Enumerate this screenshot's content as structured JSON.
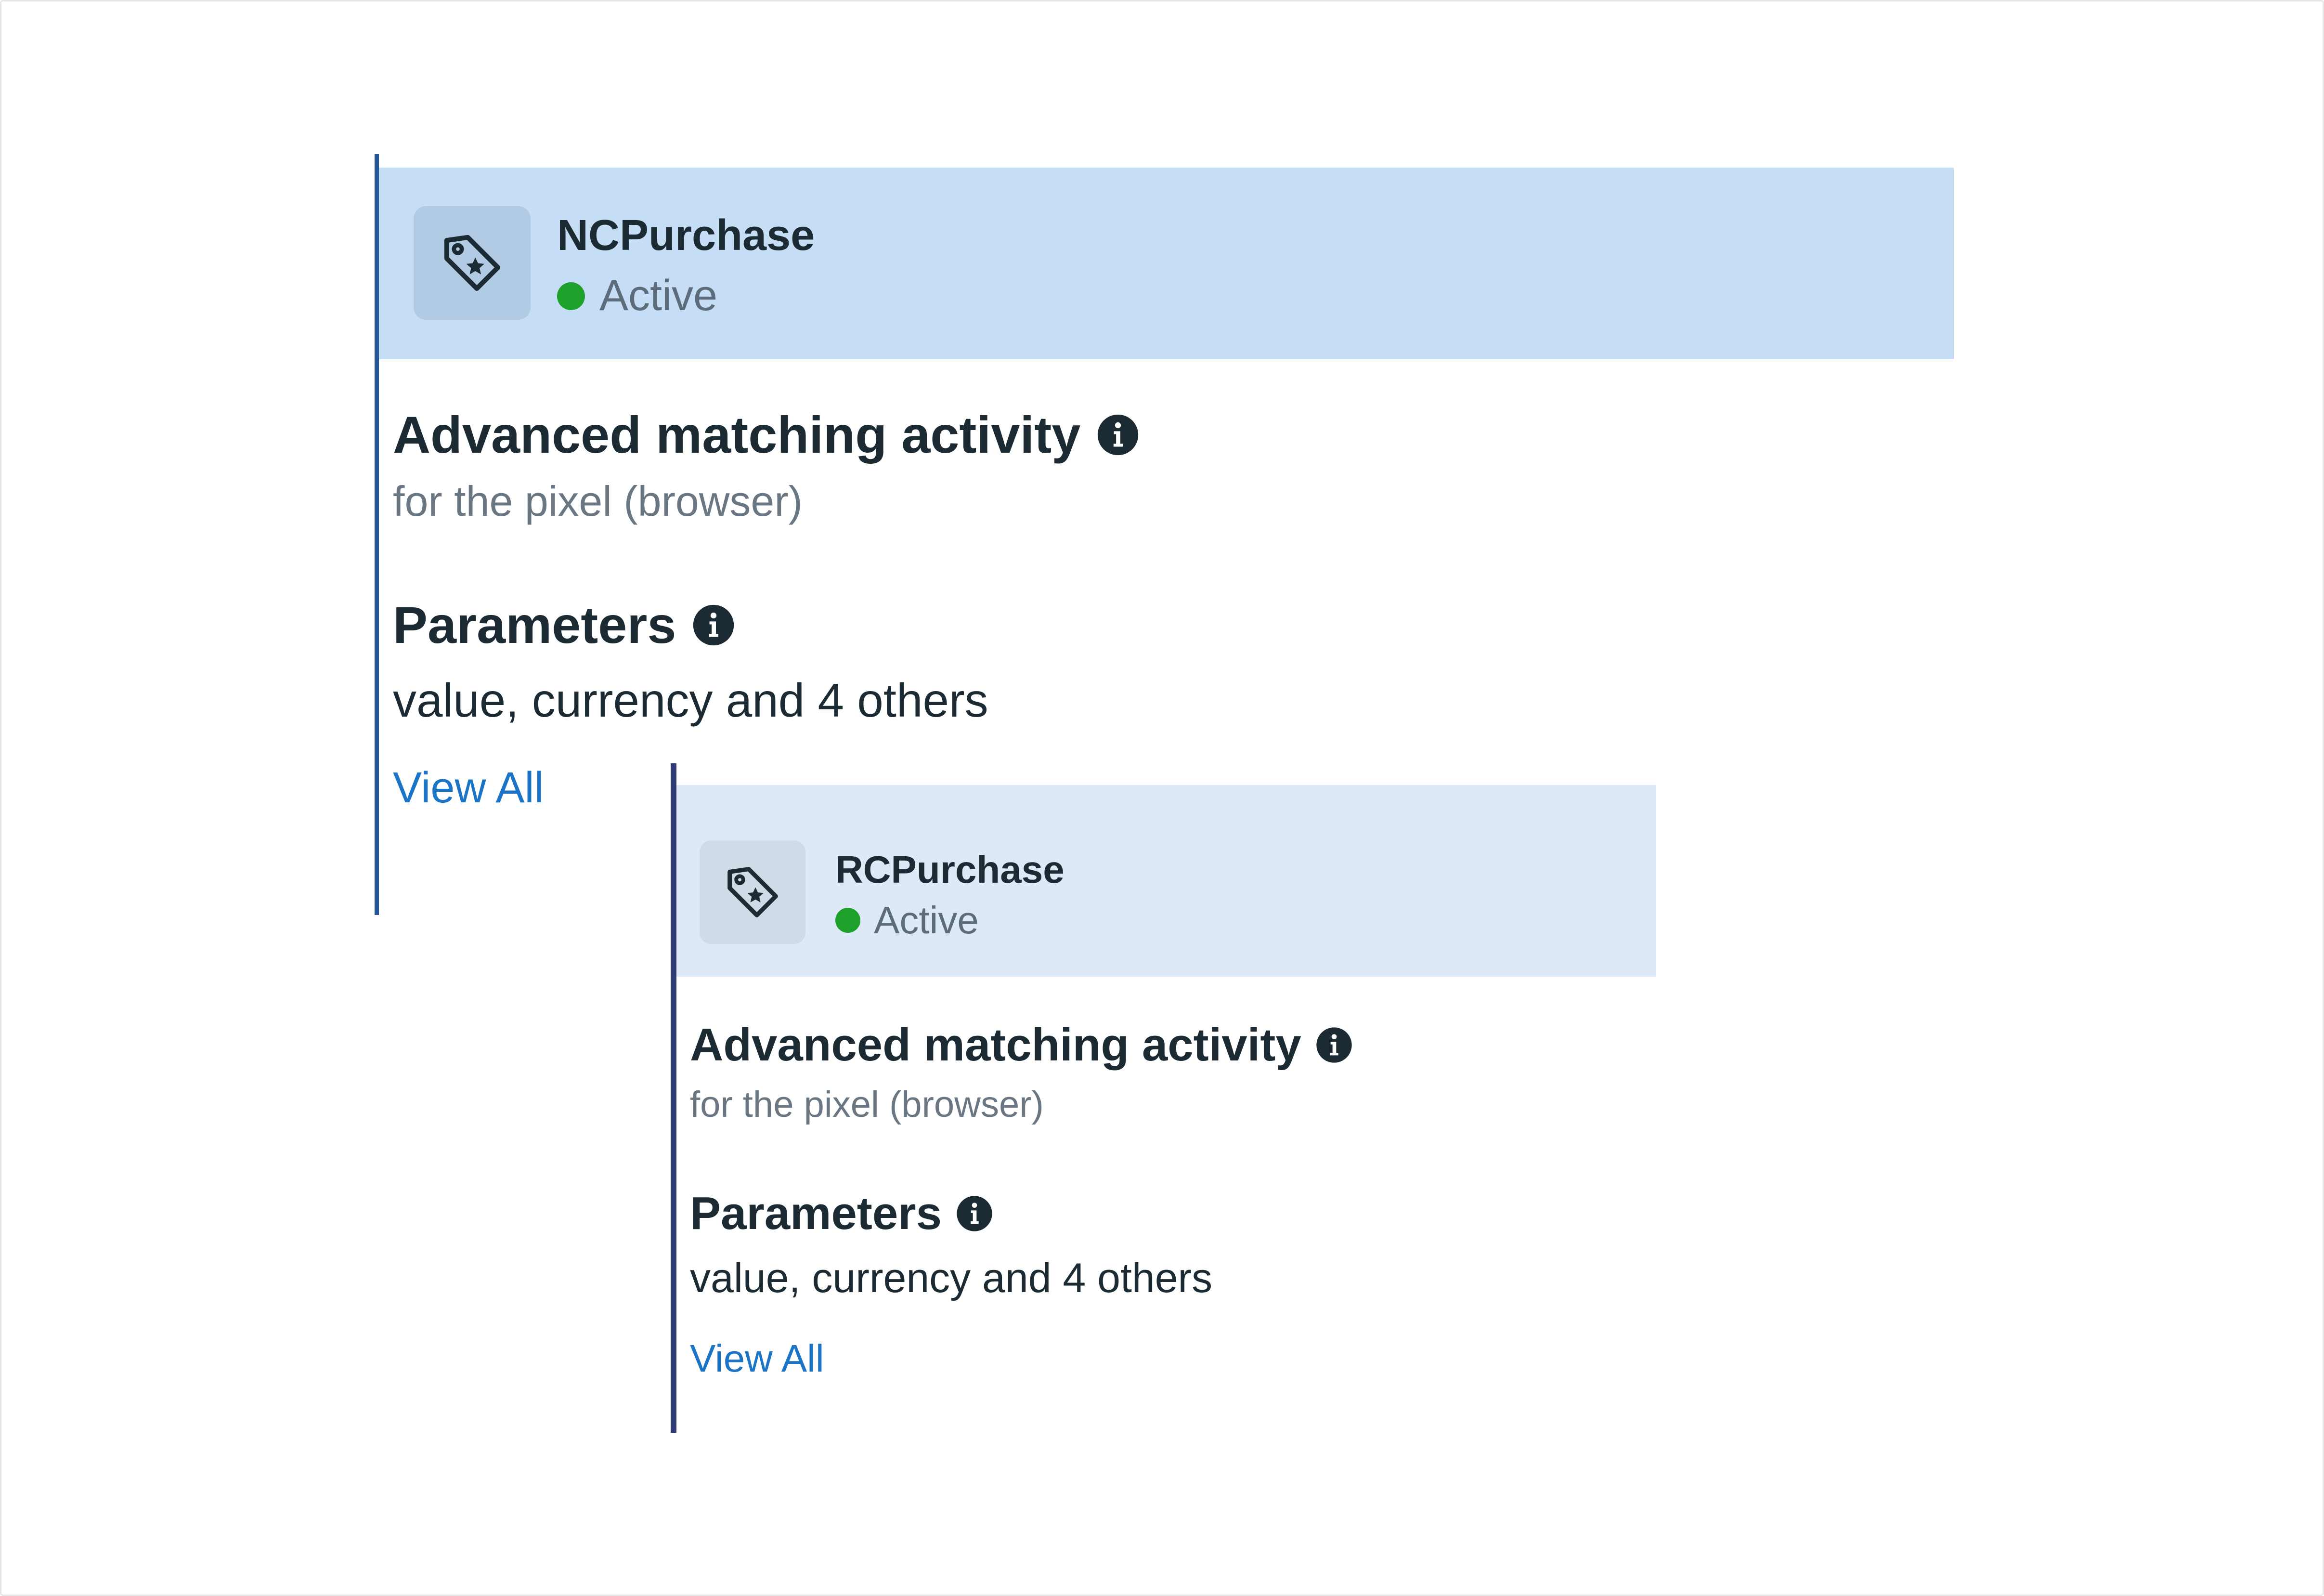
{
  "colors": {
    "accent_link": "#1b74c5",
    "status_active": "#1ea12a",
    "card1_header_bg": "#c5ddf5",
    "card2_header_bg": "#dde9f6",
    "card1_rule": "#24579a",
    "card2_rule": "#2e3a73"
  },
  "cards": [
    {
      "event_name": "NCPurchase",
      "event_icon": "tag-icon",
      "status": "Active",
      "advanced_matching": {
        "title": "Advanced matching activity",
        "info_icon": "info-icon",
        "subtitle": "for the pixel (browser)"
      },
      "parameters": {
        "title": "Parameters",
        "info_icon": "info-icon",
        "value": "value, currency and 4 others",
        "link_label": "View All"
      }
    },
    {
      "event_name": "RCPurchase",
      "event_icon": "tag-icon",
      "status": "Active",
      "advanced_matching": {
        "title": "Advanced matching activity",
        "info_icon": "info-icon",
        "subtitle": "for the pixel (browser)"
      },
      "parameters": {
        "title": "Parameters",
        "info_icon": "info-icon",
        "value": "value, currency and 4 others",
        "link_label": "View All"
      }
    }
  ]
}
